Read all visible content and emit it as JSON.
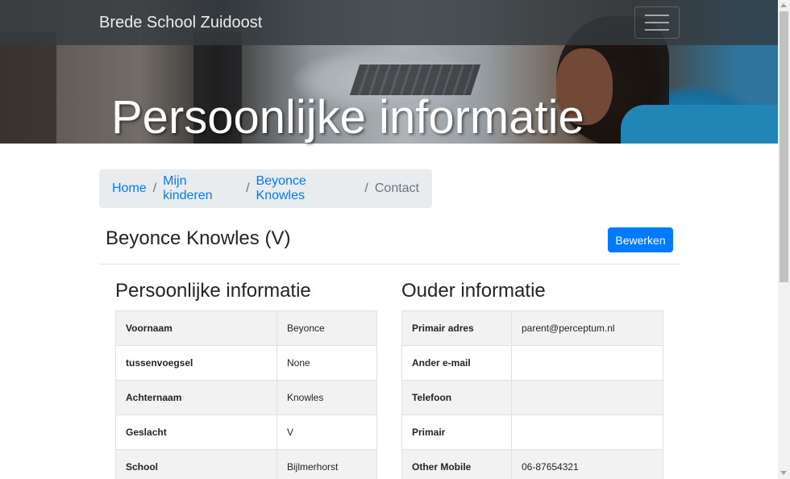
{
  "navbar": {
    "brand": "Brede School Zuidoost",
    "toggle_icon": "hamburger-icon"
  },
  "hero": {
    "title": "Persoonlijke informatie"
  },
  "breadcrumb": {
    "items": [
      "Home",
      "Mijn kinderen",
      "Beyonce Knowles"
    ],
    "active": "Contact"
  },
  "child": {
    "name": "Beyonce Knowles (V)",
    "edit_label": "Bewerken"
  },
  "personal": {
    "title": "Persoonlijke informatie",
    "rows": [
      {
        "key": "Voornaam",
        "value": "Beyonce"
      },
      {
        "key": "tussenvoegsel",
        "value": "None"
      },
      {
        "key": "Achternaam",
        "value": "Knowles"
      },
      {
        "key": "Geslacht",
        "value": "V"
      },
      {
        "key": "School",
        "value": "Bijlmerhorst"
      }
    ]
  },
  "parent": {
    "title": "Ouder informatie",
    "rows": [
      {
        "key": "Primair adres",
        "value": "parent@perceptum.nl"
      },
      {
        "key": "Ander e-mail",
        "value": ""
      },
      {
        "key": "Telefoon",
        "value": ""
      },
      {
        "key": "Primair",
        "value": ""
      },
      {
        "key": "Other Mobile",
        "value": "06-87654321"
      }
    ]
  },
  "colors": {
    "primary": "#007bff",
    "navbar_bg": "#343a40",
    "breadcrumb_bg": "#e9ecef",
    "table_stripe": "#f2f2f2"
  }
}
